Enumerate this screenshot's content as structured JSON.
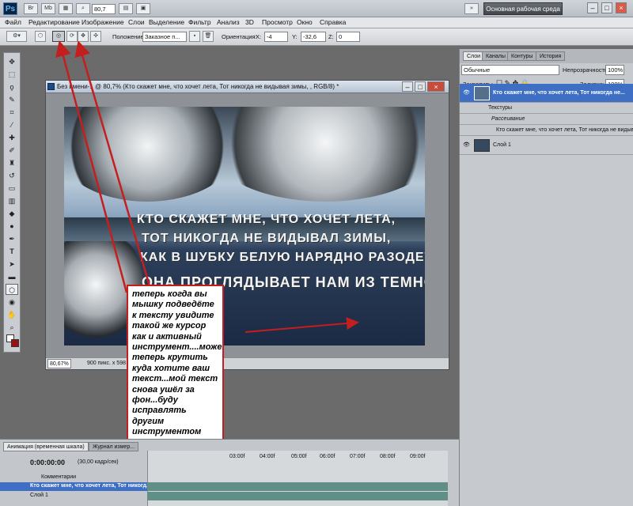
{
  "app": {
    "logo": "Ps",
    "workspace_button": "Основная рабочая среда",
    "zoom_value": "80,7",
    "window_controls": [
      "–",
      "□",
      "×"
    ]
  },
  "menu": [
    "Файл",
    "Редактирование",
    "Изображение",
    "Слои",
    "Выделение",
    "Фильтр",
    "Анализ",
    "3D",
    "Просмотр",
    "Окно",
    "Справка"
  ],
  "options": {
    "position_label": "Положение:",
    "position_value": "Заказное п...",
    "orientation_label": "Ориентация:",
    "x_label": "X:",
    "x_value": "-4",
    "y_label": "Y:",
    "y_value": "-32,6",
    "z_label": "Z:",
    "z_value": "0"
  },
  "document": {
    "title": "Без имени-1 @ 80,7% (Кто скажет мне, что хочет лета,   Тот никогда не видывая зимы, , RGB/8) *",
    "status_zoom": "80,67%",
    "status_info": "900 пикс. x 598 пикс."
  },
  "canvas_text": {
    "line1": "КТО СКАЖЕТ МНЕ, ЧТО ХОЧЕТ ЛЕТА,",
    "line2": "ТОТ НИКОГДА НЕ ВИДЫВАЛ ЗИМЫ,",
    "line3": "КАК В ШУБКУ БЕЛУЮ НАРЯДНО РАЗОДЕТ",
    "line4": "ОНА ПРОГЛЯДЫВАЕТ НАМ ИЗ ТЕМНОТЫ"
  },
  "note": "теперь когда вы мышку подведёте к тексту увидите такой же курсор как и активный инструмент....можете теперь крутить куда хотите ваш текст...мой текст снова ушёл за фон...буду исправлять другим инструментом",
  "layers_panel": {
    "tabs": [
      "Слои",
      "Каналы",
      "Контуры",
      "История"
    ],
    "blend_mode": "Обычные",
    "opacity_label": "Непрозрачность:",
    "opacity_value": "100%",
    "lock_label": "Закрепить:",
    "fill_label": "Заливка:",
    "fill_value": "100%",
    "layer_text": "Кто скажет мне, что хочет лета,   Тот никогда не...",
    "effects": "Текстуры",
    "effect_sub": "Рассеивание",
    "effect_layer": "Кто скажет мне, что хочет лета,   Тот никогда не видывая...",
    "layer1": "Слой 1"
  },
  "timeline": {
    "tabs": [
      "Анимация (временная шкала)",
      "Журнал измер..."
    ],
    "time": "0:00:00:00",
    "fps": "(30,00 кадр/сек)",
    "ticks": [
      "03:00f",
      "04:00f",
      "05:00f",
      "06:00f",
      "07:00f",
      "08:00f",
      "09:00f"
    ],
    "comments": "Комментарии",
    "row_text": "Кто скажет мне, что хочет лета,   Тот никогд...",
    "row_layer1": "Слой 1"
  },
  "colors": {
    "note_border": "#c41f1f",
    "arrow": "#c41f1f",
    "selected_layer": "#3e6fc4"
  }
}
